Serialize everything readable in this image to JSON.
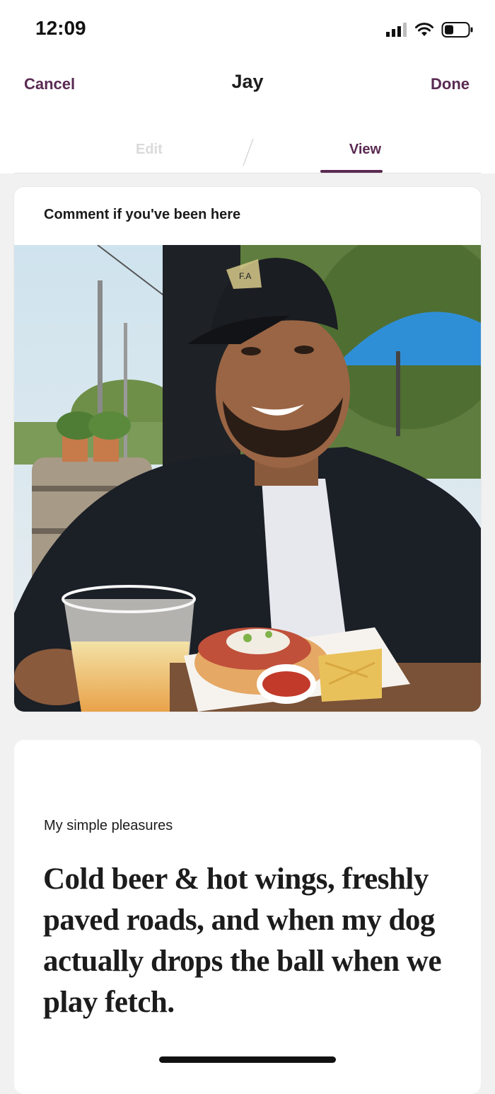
{
  "status_bar": {
    "time": "12:09",
    "icons": [
      "signal-icon",
      "wifi-icon",
      "battery-icon"
    ]
  },
  "header": {
    "cancel_label": "Cancel",
    "title": "Jay",
    "done_label": "Done"
  },
  "tabs": {
    "edit_label": "Edit",
    "view_label": "View",
    "active": "View"
  },
  "photo_card": {
    "prompt": "Comment if you've been here",
    "photo_badge": "F.A"
  },
  "text_card": {
    "label": "My simple pleasures",
    "answer": "Cold beer & hot wings, freshly paved roads, and when my dog actually drops the ball when we play fetch."
  },
  "colors": {
    "accent": "#5a2a52",
    "background": "#f1f1f1",
    "card": "#ffffff",
    "umbrella": "#2f8fd6"
  }
}
